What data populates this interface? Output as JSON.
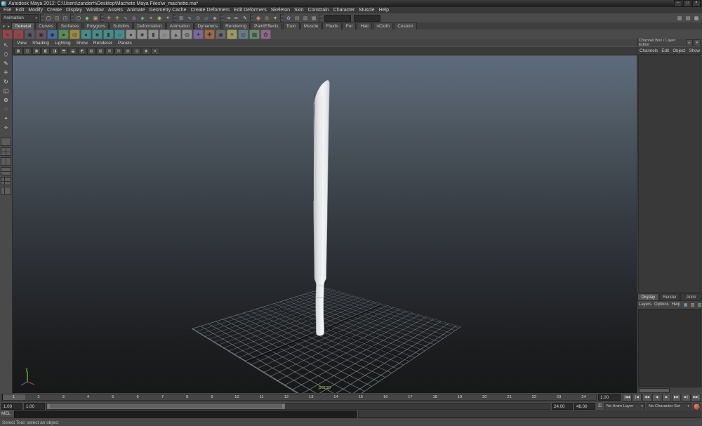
{
  "window": {
    "title": "Autodesk Maya 2012: C:\\Users\\zanderh\\Desktop\\Machete Maya Files\\w_machette.ma*",
    "controls": [
      {
        "name": "minimize-button",
        "glyph": "–"
      },
      {
        "name": "maximize-button",
        "glyph": "□"
      },
      {
        "name": "close-button",
        "glyph": "×"
      }
    ]
  },
  "menu_bar": {
    "items": [
      "File",
      "Edit",
      "Modify",
      "Create",
      "Display",
      "Window",
      "Assets",
      "Animate",
      "Geometry Cache",
      "Create Deformers",
      "Edit Deformers",
      "Skeleton",
      "Skin",
      "Constrain",
      "Character",
      "Muscle",
      "Help"
    ]
  },
  "status_line": {
    "menu_set": "Animation",
    "file_icons": [
      {
        "name": "new-scene-icon",
        "glyph": "▢",
        "color": "#d6d6d6"
      },
      {
        "name": "open-scene-icon",
        "glyph": "◫",
        "color": "#c9b87a"
      },
      {
        "name": "save-scene-icon",
        "glyph": "◳",
        "color": "#9fb6c9"
      }
    ],
    "selection_mode_icons": [
      {
        "name": "select-hierarchy-icon",
        "glyph": "⬡",
        "color": "#c9c9c9"
      },
      {
        "name": "select-object-icon",
        "glyph": "◆",
        "color": "#7ac47a"
      },
      {
        "name": "select-component-icon",
        "glyph": "▣",
        "color": "#c4a57a"
      }
    ],
    "selection_mask_icons": [
      {
        "name": "mask-handles-icon",
        "glyph": "✚",
        "color": "#c97a7a"
      },
      {
        "name": "mask-joints-icon",
        "glyph": "✛",
        "color": "#c9c97a"
      },
      {
        "name": "mask-curves-icon",
        "glyph": "∿",
        "color": "#7ab0c9"
      },
      {
        "name": "mask-surfaces-icon",
        "glyph": "◍",
        "color": "#9a7ac9"
      },
      {
        "name": "mask-deformations-icon",
        "glyph": "◈",
        "color": "#7ac4b0"
      },
      {
        "name": "mask-dynamics-icon",
        "glyph": "✦",
        "color": "#c98a7a"
      },
      {
        "name": "mask-rendering-icon",
        "glyph": "◉",
        "color": "#b0c97a"
      },
      {
        "name": "mask-misc-icon",
        "glyph": "●",
        "color": "#9f9f9f"
      }
    ],
    "snap_icons": [
      {
        "name": "snap-to-grid-icon",
        "glyph": "⊞",
        "color": "#9fb6c9"
      },
      {
        "name": "snap-to-curve-icon",
        "glyph": "∿",
        "color": "#9fb6c9"
      },
      {
        "name": "snap-to-point-icon",
        "glyph": "⊙",
        "color": "#9fb6c9"
      },
      {
        "name": "snap-to-view-plane-icon",
        "glyph": "▱",
        "color": "#9fb6c9"
      },
      {
        "name": "make-live-icon",
        "glyph": "◈",
        "color": "#9fb6c9"
      }
    ],
    "history_icons": [
      {
        "name": "input-connections-icon",
        "glyph": "⇥",
        "color": "#c9c9c9"
      },
      {
        "name": "output-connections-icon",
        "glyph": "⇤",
        "color": "#c9c9c9"
      },
      {
        "name": "construction-history-icon",
        "glyph": "✎",
        "color": "#c9c9c9"
      }
    ],
    "render_icons": [
      {
        "name": "render-current-frame-icon",
        "glyph": "◉",
        "color": "#c9a57a"
      },
      {
        "name": "ipr-render-icon",
        "glyph": "◎",
        "color": "#c9a57a"
      },
      {
        "name": "render-settings-icon",
        "glyph": "✦",
        "color": "#c9c9c9"
      }
    ],
    "misc_icons": [
      {
        "name": "paint-effects-icon",
        "glyph": "✿",
        "color": "#ab8ac9"
      },
      {
        "name": "toggle-grid-icon",
        "glyph": "▤",
        "color": "#9f9f9f"
      },
      {
        "name": "toggle-panel-icon",
        "glyph": "▥",
        "color": "#9f9f9f"
      },
      {
        "name": "toggle-view-icon",
        "glyph": "▦",
        "color": "#9f9f9f"
      }
    ],
    "sidebar_icons": [
      {
        "name": "attribute-editor-toggle-icon",
        "glyph": "▥",
        "color": "#c0c0c0"
      },
      {
        "name": "tool-settings-toggle-icon",
        "glyph": "▤",
        "color": "#c0c0c0"
      },
      {
        "name": "channel-box-toggle-icon",
        "glyph": "▦",
        "color": "#c0c0c0"
      }
    ]
  },
  "shelf": {
    "tabs": [
      {
        "label": "General",
        "active": true
      },
      {
        "label": "Curves"
      },
      {
        "label": "Surfaces"
      },
      {
        "label": "Polygons"
      },
      {
        "label": "Subdivs"
      },
      {
        "label": "Deformation"
      },
      {
        "label": "Animation"
      },
      {
        "label": "Dynamics"
      },
      {
        "label": "Rendering"
      },
      {
        "label": "PaintEffects"
      },
      {
        "label": "Toon"
      },
      {
        "label": "Muscle"
      },
      {
        "label": "Fluids"
      },
      {
        "label": "Fur"
      },
      {
        "label": "Hair"
      },
      {
        "label": "nCloth"
      },
      {
        "label": "Custom"
      }
    ],
    "icons": [
      {
        "name": "shelf-curve-tool-icon",
        "glyph": "∿",
        "color": "#8a4a4a"
      },
      {
        "name": "shelf-curve-circle-icon",
        "glyph": "○",
        "color": "#8a4a4a"
      },
      {
        "name": "shelf-history-icon",
        "glyph": "▣",
        "color": "#5a5a66"
      },
      {
        "name": "shelf-delete-history-icon",
        "glyph": "▣",
        "color": "#6a5660"
      },
      {
        "name": "shelf-blue-node-icon",
        "glyph": "◆",
        "color": "#4a6a9a"
      },
      {
        "name": "shelf-green-node-icon",
        "glyph": "●",
        "color": "#5a8a5a"
      },
      {
        "name": "shelf-yellow-node-icon",
        "glyph": "◎",
        "color": "#9a8a4a"
      },
      {
        "name": "shelf-nurbs-sphere-icon",
        "glyph": "●",
        "color": "#4a8a8a"
      },
      {
        "name": "shelf-nurbs-cube-icon",
        "glyph": "■",
        "color": "#4a8a8a"
      },
      {
        "name": "shelf-nurbs-cylinder-icon",
        "glyph": "▮",
        "color": "#4a8a8a"
      },
      {
        "name": "shelf-nurbs-plane-icon",
        "glyph": "▱",
        "color": "#4a8a8a"
      },
      {
        "name": "shelf-poly-sphere-icon",
        "glyph": "●",
        "color": "#8f8f8f"
      },
      {
        "name": "shelf-poly-cube-icon",
        "glyph": "■",
        "color": "#8f8f8f"
      },
      {
        "name": "shelf-poly-cylinder-icon",
        "glyph": "▮",
        "color": "#8f8f8f"
      },
      {
        "name": "shelf-poly-plane-icon",
        "glyph": "▱",
        "color": "#8f8f8f"
      },
      {
        "name": "shelf-poly-cone-icon",
        "glyph": "▲",
        "color": "#8f8f8f"
      },
      {
        "name": "shelf-poly-torus-icon",
        "glyph": "◍",
        "color": "#8f8f8f"
      },
      {
        "name": "shelf-purple-tool-icon",
        "glyph": "✦",
        "color": "#7a6a9a"
      },
      {
        "name": "shelf-orange-tool-icon",
        "glyph": "✚",
        "color": "#9a6a4a"
      },
      {
        "name": "shelf-render-icon",
        "glyph": "◉",
        "color": "#6a6a6a"
      },
      {
        "name": "shelf-light-icon",
        "glyph": "☀",
        "color": "#9a9a6a"
      },
      {
        "name": "shelf-camera-icon",
        "glyph": "◎",
        "color": "#6a7a8a"
      },
      {
        "name": "shelf-texture-icon",
        "glyph": "▦",
        "color": "#6a8a6a"
      },
      {
        "name": "shelf-misc-icon",
        "glyph": "✿",
        "color": "#8a6a8a"
      }
    ]
  },
  "toolbox": {
    "tools": [
      {
        "name": "select-tool-icon",
        "glyph": "↖"
      },
      {
        "name": "lasso-tool-icon",
        "glyph": "⬯"
      },
      {
        "name": "paint-select-tool-icon",
        "glyph": "✎"
      },
      {
        "name": "move-tool-icon",
        "glyph": "✛"
      },
      {
        "name": "rotate-tool-icon",
        "glyph": "↻"
      },
      {
        "name": "scale-tool-icon",
        "glyph": "◱"
      },
      {
        "name": "universal-manipulator-icon",
        "glyph": "⊕"
      },
      {
        "name": "soft-mod-tool-icon",
        "glyph": "◌"
      },
      {
        "name": "show-manipulator-icon",
        "glyph": "⌖"
      },
      {
        "name": "last-tool-icon",
        "glyph": "⟡"
      }
    ],
    "layouts": [
      {
        "name": "layout-single-pane-button",
        "cls": "l1"
      },
      {
        "name": "layout-four-pane-button",
        "cls": "l4"
      },
      {
        "name": "layout-two-pane-side-button",
        "cls": "l2v"
      },
      {
        "name": "layout-two-pane-stacked-button",
        "cls": "l2h"
      },
      {
        "name": "layout-three-pane-button",
        "cls": "l3"
      },
      {
        "name": "layout-outliner-persp-button",
        "cls": "l2o"
      }
    ]
  },
  "viewport": {
    "menus": [
      "View",
      "Shading",
      "Lighting",
      "Show",
      "Renderer",
      "Panels"
    ],
    "toolbar_icons": [
      "▦",
      "◫",
      "▣",
      "◧",
      "◨",
      "⬒",
      "⬓",
      "◩",
      "▤",
      "▥",
      "⊞",
      "⊟",
      "◍",
      "◎",
      "◉",
      "●"
    ],
    "camera_label": "persp"
  },
  "channel_box": {
    "header": "Channel Box / Layer Editor",
    "header_icons": [
      {
        "name": "channel-box-manipulator-icon",
        "glyph": "▸"
      },
      {
        "name": "channel-box-speed-icon",
        "glyph": "▾"
      }
    ],
    "menus": [
      "Channels",
      "Edit",
      "Object",
      "Show"
    ]
  },
  "layer_editor": {
    "tabs": [
      {
        "label": "Display",
        "active": true
      },
      {
        "label": "Render"
      },
      {
        "label": "Anim"
      }
    ],
    "menus": [
      "Layers",
      "Options",
      "Help"
    ],
    "icons": [
      {
        "name": "layer-save-icon",
        "glyph": "▦",
        "color": "#9ab0c4"
      },
      {
        "name": "layer-new-empty-icon",
        "glyph": "▧",
        "color": "#c4b09a"
      },
      {
        "name": "layer-new-from-selected-icon",
        "glyph": "▨",
        "color": "#9ac49a"
      },
      {
        "name": "layer-options-icon",
        "glyph": "▩",
        "color": "#c49a9a"
      }
    ]
  },
  "timeline": {
    "ticks": [
      "1",
      "2",
      "3",
      "4",
      "5",
      "6",
      "7",
      "8",
      "9",
      "10",
      "11",
      "12",
      "13",
      "14",
      "15",
      "16",
      "17",
      "18",
      "19",
      "20",
      "21",
      "22",
      "23",
      "24"
    ],
    "current_time": "1.00",
    "playback": [
      {
        "name": "go-to-start-button",
        "glyph": "|◀◀"
      },
      {
        "name": "step-back-frame-button",
        "glyph": "|◀"
      },
      {
        "name": "step-back-key-button",
        "glyph": "◀◀"
      },
      {
        "name": "play-backwards-button",
        "glyph": "◀"
      },
      {
        "name": "play-forwards-button",
        "glyph": "▶"
      },
      {
        "name": "step-forward-key-button",
        "glyph": "▶▶"
      },
      {
        "name": "step-forward-frame-button",
        "glyph": "▶|"
      },
      {
        "name": "go-to-end-button",
        "glyph": "▶▶|"
      }
    ]
  },
  "range_slider": {
    "anim_start": "1.00",
    "playback_start": "1.00",
    "playback_end": "24.00",
    "anim_end": "48.00",
    "anim_layer": "No Anim Layer",
    "character_set": "No Character Set"
  },
  "command_line": {
    "label": "MEL"
  },
  "help_line": {
    "text": "Select Tool: select an object"
  }
}
